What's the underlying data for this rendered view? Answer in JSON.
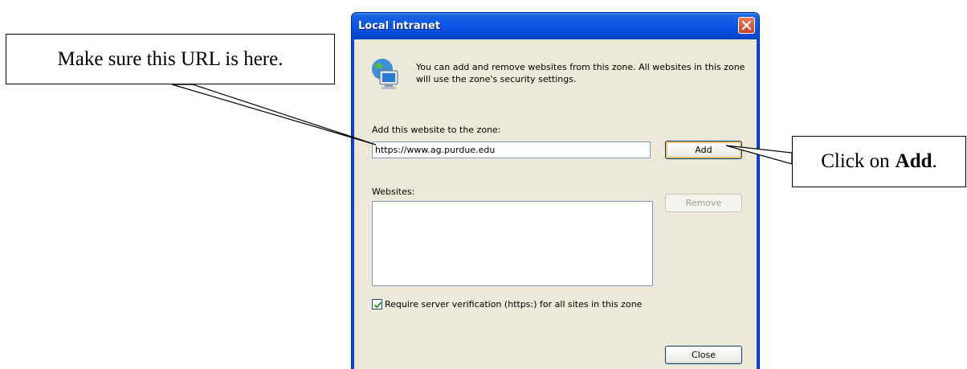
{
  "callouts": {
    "left_text": "Make sure this URL is here.",
    "right_prefix": "Click on",
    "right_bold": "Add",
    "right_suffix": "."
  },
  "dialog": {
    "title": "Local intranet",
    "description": "You can add and remove websites from this zone. All websites in this zone will use the zone's security settings.",
    "add_label": "Add this website to the zone:",
    "url_value": "https://www.ag.purdue.edu",
    "add_button": "Add",
    "websites_label": "Websites:",
    "remove_button": "Remove",
    "verify_checked": true,
    "verify_label": "Require server verification (https:) for all sites in this zone",
    "close_button": "Close"
  },
  "colors": {
    "titlebar": "#0a55e8",
    "client": "#ece9d8",
    "close_x": "#d4553a"
  },
  "icons": [
    "close-icon",
    "zone-globe-computer-icon",
    "checkmark-icon"
  ]
}
